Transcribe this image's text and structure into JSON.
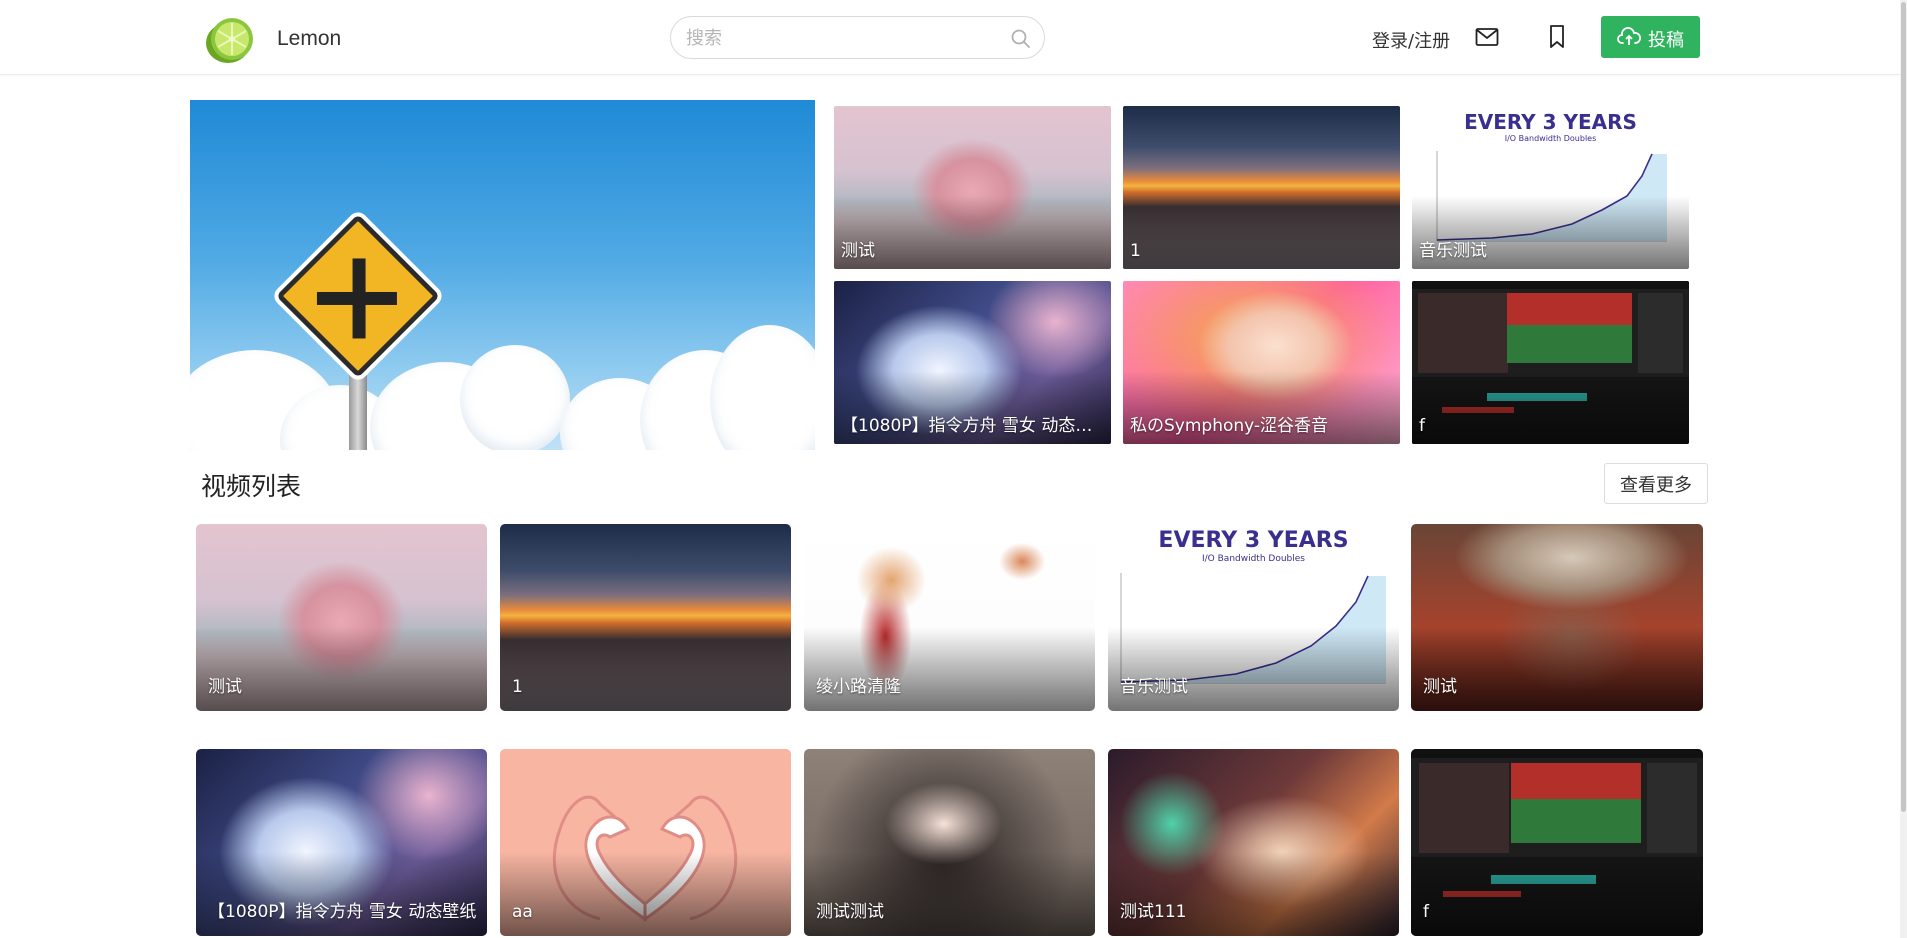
{
  "header": {
    "brand": "Lemon",
    "search_placeholder": "搜索",
    "login_label": "登录/注册",
    "upload_label": "投稿",
    "icons": {
      "logo": "lime-logo",
      "search": "search-icon",
      "mail": "mail-icon",
      "bookmark": "bookmark-icon",
      "upload": "cloud-upload-icon"
    },
    "colors": {
      "accent": "#2fb35f"
    }
  },
  "banner": {
    "active_slide": 1,
    "slide_count": 2,
    "prev": "‹",
    "next": "›"
  },
  "featured": [
    {
      "title": "测试"
    },
    {
      "title": "1"
    },
    {
      "title": "音乐测试"
    },
    {
      "title": "【1080P】指令方舟 雪女 动态壁纸"
    },
    {
      "title": "私のSymphony-涩谷香音"
    },
    {
      "title": "f"
    }
  ],
  "chart_thumb": {
    "heading": "EVERY 3 YEARS",
    "subheading": "I/O Bandwidth Doubles"
  },
  "video_list": {
    "title": "视频列表",
    "more_label": "查看更多",
    "items": [
      {
        "title": "测试"
      },
      {
        "title": "1"
      },
      {
        "title": "绫小路清隆"
      },
      {
        "title": "音乐测试"
      },
      {
        "title": "测试"
      },
      {
        "title": "【1080P】指令方舟 雪女 动态壁纸"
      },
      {
        "title": "aa"
      },
      {
        "title": "测试测试"
      },
      {
        "title": "测试111"
      },
      {
        "title": "f"
      }
    ]
  }
}
